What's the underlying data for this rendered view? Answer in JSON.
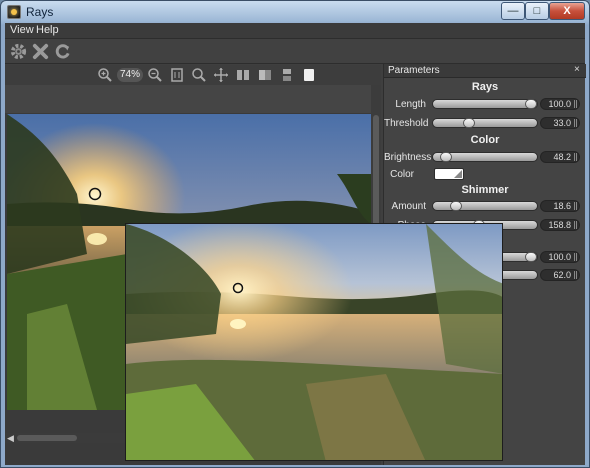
{
  "window": {
    "title": "Rays",
    "min_label": "—",
    "max_label": "□",
    "close_label": "X"
  },
  "menu": {
    "items": [
      "View",
      "Help"
    ]
  },
  "toolbar": {
    "icons": [
      "gear-icon",
      "close-x-icon",
      "refresh-icon"
    ]
  },
  "view_toolbar": {
    "zoom_value": "74%",
    "icons": [
      "zoom-in-icon",
      "zoom-out-icon",
      "fit-icon",
      "zoom-tool-icon",
      "pan-icon",
      "split-vertical-icon",
      "split-horizontal-icon",
      "split-stack-icon",
      "single-view-icon"
    ]
  },
  "panel": {
    "title": "Parameters",
    "close": "×",
    "sections": {
      "rays": "Rays",
      "color": "Color",
      "shimmer": "Shimmer"
    },
    "length": {
      "label": "Length",
      "value": "100.0",
      "fraction": 1.0
    },
    "threshold": {
      "label": "Threshold",
      "value": "33.0",
      "fraction": 0.33
    },
    "brightness": {
      "label": "Brightness",
      "value": "48.2",
      "fraction": 0.08
    },
    "color_field": {
      "label": "Color",
      "swatch": "#ffffff"
    },
    "amount": {
      "label": "Amount",
      "value": "18.6",
      "fraction": 0.19
    },
    "phase": {
      "label": "Phase",
      "value": "158.8",
      "fraction": 0.44
    },
    "hidden1": {
      "value": "100.0",
      "fraction": 1.0
    },
    "hidden2": {
      "value": "62.0",
      "fraction": 0.62
    }
  }
}
